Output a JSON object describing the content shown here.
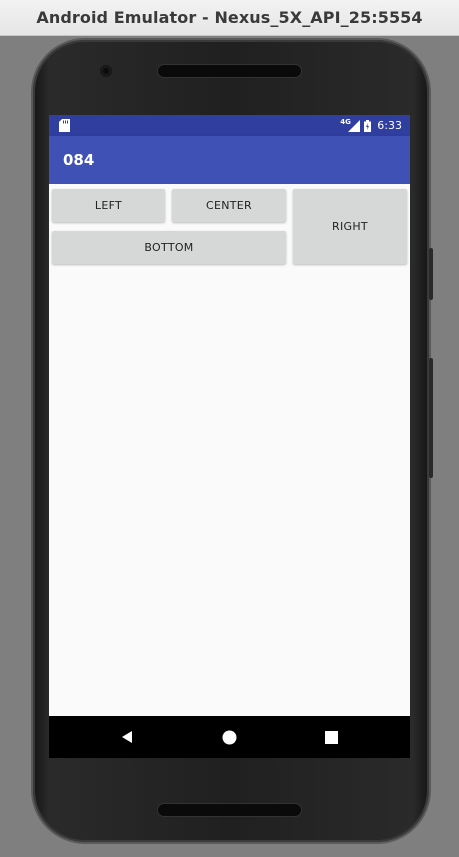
{
  "window": {
    "title": "Android Emulator - Nexus_5X_API_25:5554"
  },
  "statusbar": {
    "network_label": "4G",
    "time": "6:33"
  },
  "appbar": {
    "title": "084"
  },
  "buttons": {
    "left": "LEFT",
    "center": "CENTER",
    "right": "RIGHT",
    "bottom": "BOTTOM"
  },
  "navbar": {
    "items": [
      "back-icon",
      "home-icon",
      "recents-icon"
    ]
  },
  "colors": {
    "status_bar": "#303f9f",
    "app_bar": "#3f51b5",
    "button": "#d6d7d7",
    "screen_background": "#fafafa",
    "nav_bar": "#000000"
  }
}
